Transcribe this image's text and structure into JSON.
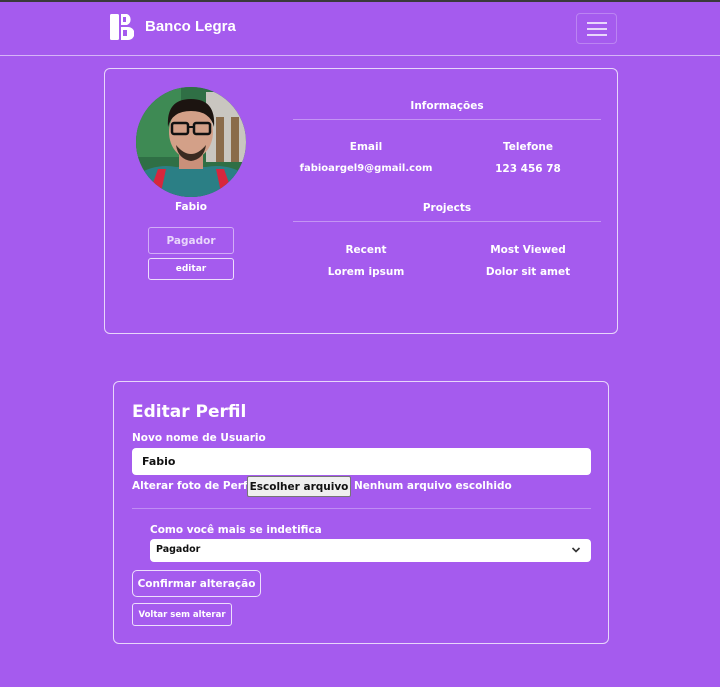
{
  "navbar": {
    "brand": "Banco Legra"
  },
  "profile": {
    "name": "Fabio",
    "role_button": "Pagador",
    "edit_button": "editar",
    "info_heading": "Informações",
    "email_label": "Email",
    "email_value": "fabioargel9@gmail.com",
    "phone_label": "Telefone",
    "phone_value": "123 456 78",
    "projects_heading": "Projects",
    "recent_label": "Recent",
    "recent_value": "Lorem ipsum",
    "most_viewed_label": "Most Viewed",
    "most_viewed_value": "Dolor sit amet"
  },
  "edit_form": {
    "title": "Editar Perfil",
    "username_label": "Novo nome de Usuario",
    "username_value": "Fabio",
    "photo_label": "Alterar foto de Perfil",
    "file_button": "Escolher arquivo",
    "file_status": "Nenhum arquivo escolhido",
    "select_label": "Como você mais se indetifica",
    "select_value": "Pagador",
    "confirm_button": "Confirmar alteração",
    "back_button": "Voltar sem alterar"
  },
  "colors": {
    "background": "#a55bee",
    "border": "#ffffff"
  },
  "icons": {
    "menu": "hamburger-icon",
    "select": "chevron-down-icon",
    "logo": "bank-logo-icon"
  }
}
